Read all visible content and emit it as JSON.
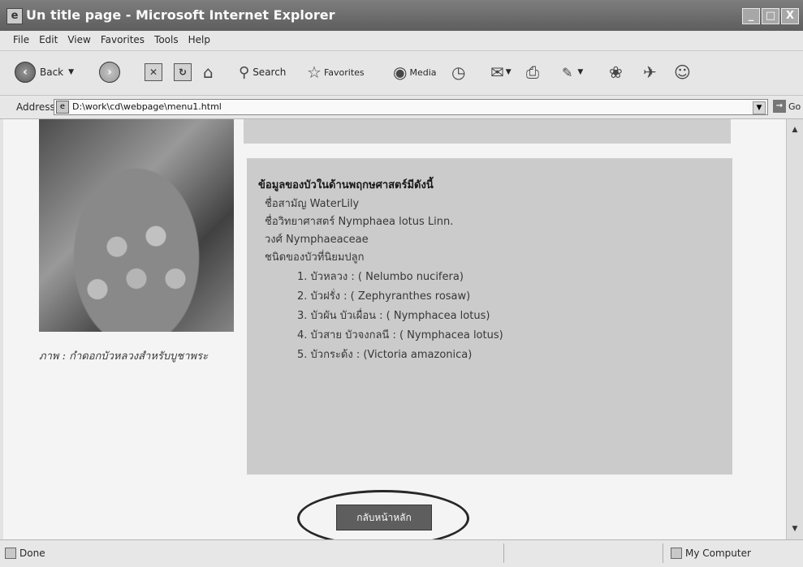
{
  "window": {
    "title": "Un title page - Microsoft Internet Explorer",
    "app_icon": "ie-page-icon",
    "controls": {
      "minimize": "_",
      "maximize": "□",
      "close": "X"
    }
  },
  "menubar": {
    "items": [
      "File",
      "Edit",
      "View",
      "Favorites",
      "Tools",
      "Help"
    ]
  },
  "toolbar": {
    "back_label": "Back",
    "search_label": "Search",
    "favorites_label": "Favorites",
    "media_label": "Media"
  },
  "address": {
    "label": "Address",
    "url": "D:\\work\\cd\\webpage\\menu1.html",
    "go_label": "Go"
  },
  "page": {
    "caption": "ภาพ : กำดอกบัวหลวงสำหรับบูชาพระ",
    "heading": "ข้อมูลของบัวในด้านพฤกษศาสตร์มีดังนี้",
    "lines": [
      "ชื่อสามัญ WaterLily",
      "ชื่อวิทยาศาสตร์ Nymphaea lotus Linn.",
      "วงศ์ Nymphaeaceae",
      "ชนิดของบัวที่นิยมปลูก"
    ],
    "items": [
      "1. บัวหลวง : ( Nelumbo nucifera)",
      "2. บัวฝรั่ง : ( Zephyranthes rosaw)",
      "3. บัวผัน บัวเผื่อน : ( Nymphacea lotus)",
      "4. บัวสาย บัวจงกลนี : ( Nymphacea lotus)",
      "5. บัวกระด้ง : (Victoria amazonica)"
    ],
    "back_button": "กลับหน้าหลัก"
  },
  "status": {
    "left": "Done",
    "right": "My Computer"
  }
}
